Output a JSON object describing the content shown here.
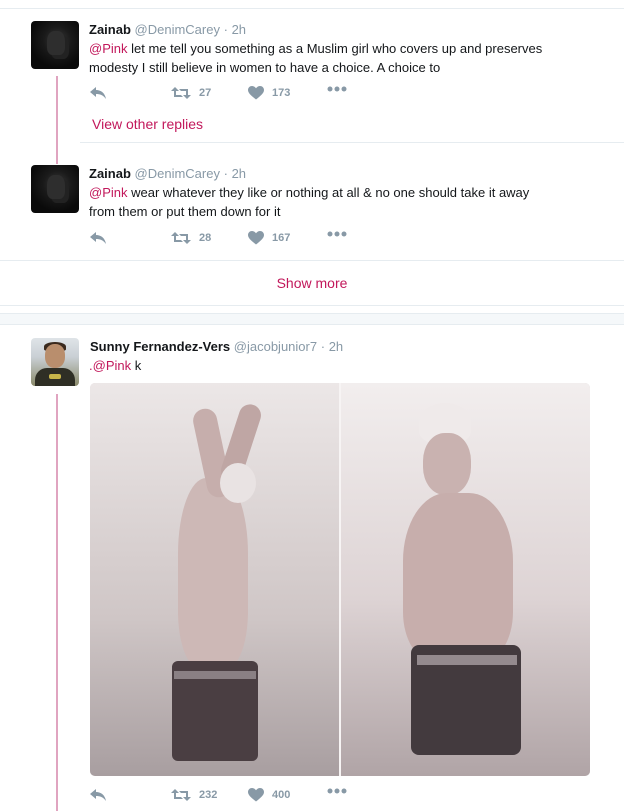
{
  "tweets": [
    {
      "name": "Zainab",
      "handle": "@DenimCarey",
      "separator": "·",
      "time": "2h",
      "mention": "@Pink",
      "text_line1": " let me tell you something as a Muslim girl who covers up and preserves",
      "text_line2": "modesty I still believe in women to have a choice. A choice to",
      "retweets": "27",
      "likes": "173"
    },
    {
      "name": "Zainab",
      "handle": "@DenimCarey",
      "separator": "·",
      "time": "2h",
      "mention": "@Pink",
      "text_line1": " wear whatever they like or nothing at all & no one should take it away",
      "text_line2": "from them or put them down for it",
      "retweets": "28",
      "likes": "167"
    },
    {
      "name": "Sunny Fernandez-Vers",
      "handle": "@jacobjunior7",
      "separator": "·",
      "time": "2h",
      "prefix": ".",
      "mention": "@Pink",
      "text_line1": " k",
      "retweets": "232",
      "likes": "400"
    }
  ],
  "view_other_replies": "View other replies",
  "show_more": "Show more",
  "icons": {
    "reply": "reply-icon",
    "retweet": "retweet-icon",
    "like": "heart-icon",
    "more": "more-icon"
  },
  "colors": {
    "accent": "#c2185b",
    "thread_line": "#e0a4c0",
    "muted": "#8899a6"
  }
}
